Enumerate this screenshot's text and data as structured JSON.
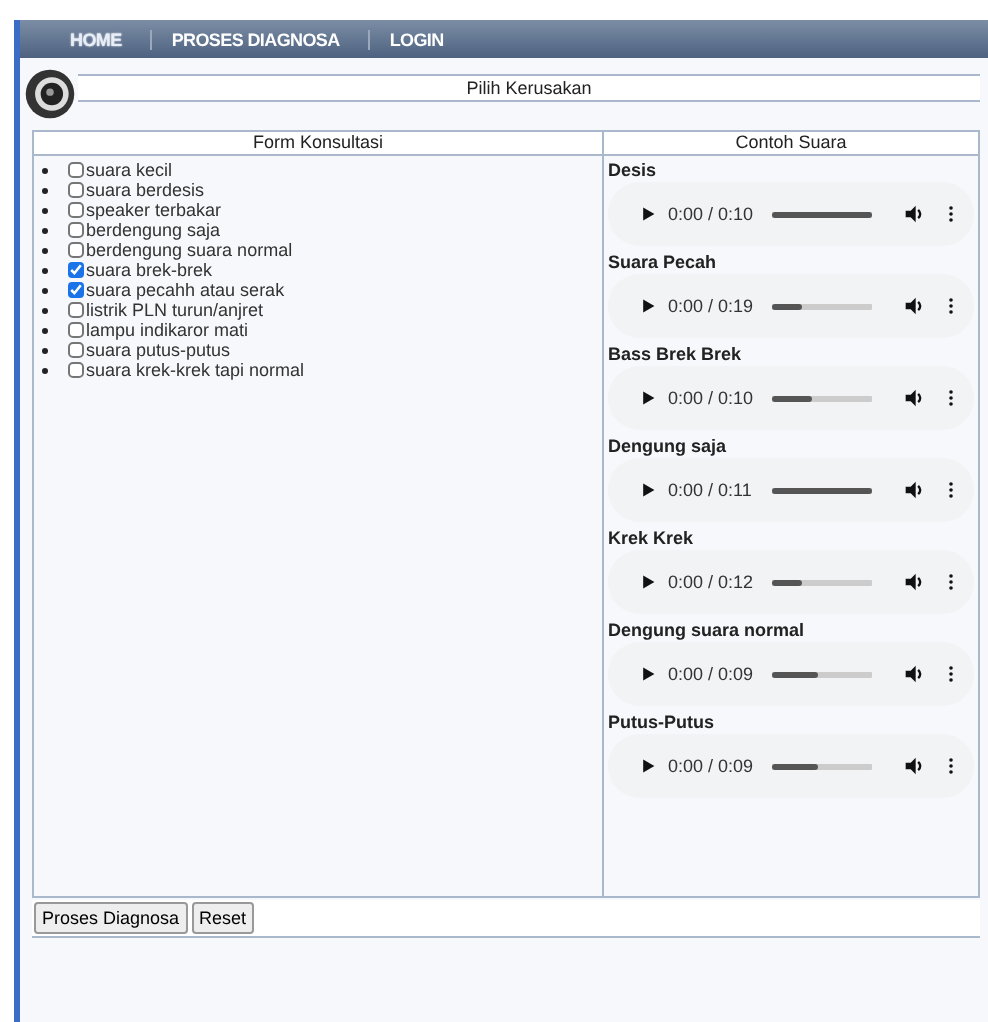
{
  "nav": [
    {
      "label": "HOME",
      "selected": true
    },
    {
      "label": "PROSES DIAGNOSA",
      "selected": false
    },
    {
      "label": "LOGIN",
      "selected": false
    }
  ],
  "header": {
    "title": "Pilih Kerusakan"
  },
  "form": {
    "heading": "Form Konsultasi",
    "items": [
      {
        "label": "suara kecil",
        "checked": false
      },
      {
        "label": "suara berdesis",
        "checked": false
      },
      {
        "label": "speaker terbakar",
        "checked": false
      },
      {
        "label": "berdengung saja",
        "checked": false
      },
      {
        "label": "berdengung suara normal",
        "checked": false
      },
      {
        "label": "suara brek-brek",
        "checked": true
      },
      {
        "label": "suara pecahh atau serak",
        "checked": true
      },
      {
        "label": "listrik PLN turun/anjret",
        "checked": false
      },
      {
        "label": "lampu indikaror mati",
        "checked": false
      },
      {
        "label": "suara putus-putus",
        "checked": false
      },
      {
        "label": "suara krek-krek tapi normal",
        "checked": false
      }
    ]
  },
  "samples": {
    "heading": "Contoh Suara",
    "items": [
      {
        "title": "Desis",
        "time": "0:00 / 0:10",
        "level": 1.0
      },
      {
        "title": "Suara Pecah",
        "time": "0:00 / 0:19",
        "level": 0.3
      },
      {
        "title": "Bass Brek Brek",
        "time": "0:00 / 0:10",
        "level": 0.4
      },
      {
        "title": "Dengung saja",
        "time": "0:00 / 0:11",
        "level": 1.0
      },
      {
        "title": "Krek Krek",
        "time": "0:00 / 0:12",
        "level": 0.3
      },
      {
        "title": "Dengung suara normal",
        "time": "0:00 / 0:09",
        "level": 0.45
      },
      {
        "title": "Putus-Putus",
        "time": "0:00 / 0:09",
        "level": 0.45
      }
    ]
  },
  "buttons": [
    "Proses Diagnosa",
    "Reset"
  ]
}
